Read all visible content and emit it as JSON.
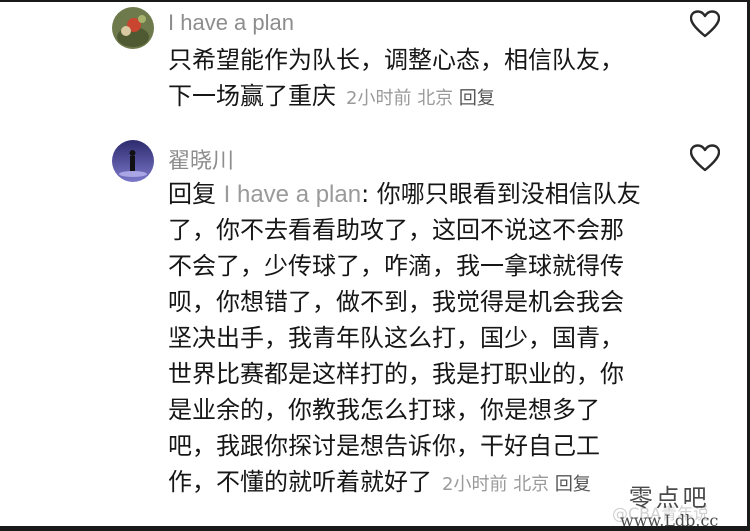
{
  "comments": [
    {
      "username": "I have a plan",
      "lines": [
        "只希望能作为队长，调整心态，相信队友，",
        "下一场赢了重庆"
      ],
      "time": "2小时前",
      "location": "北京",
      "reply_label": "回复"
    },
    {
      "username": "翟晓川",
      "reply_prefix": "回复",
      "reply_to": "I have a plan",
      "line1_rest": ": 你哪只眼看到没相信队友",
      "lines": [
        "了，你不去看看助攻了，这回不说这不会那",
        "不会了，少传球了，咋滴，我一拿球就得传",
        "呗，你想错了，做不到，我觉得是机会我会",
        "坚决出手，我青年队这么打，国少，国青，",
        "世界比赛都是这样打的，我是打职业的，你",
        "是业余的，你教我怎么打球，你是想多了",
        "吧，我跟你探讨是想告诉你，干好自己工",
        "作，不懂的就听着就好了"
      ],
      "time": "2小时前",
      "location": "北京",
      "reply_label": "回复"
    }
  ],
  "watermarks": {
    "weibo": "@CBA青年说",
    "site_cn": "零点吧",
    "site_url": "www.Ldb.cc"
  },
  "icons": {
    "like": "heart-outline-icon"
  },
  "colors": {
    "text": "#161616",
    "username": "#8d8d8d",
    "meta": "#9a9a9a"
  }
}
